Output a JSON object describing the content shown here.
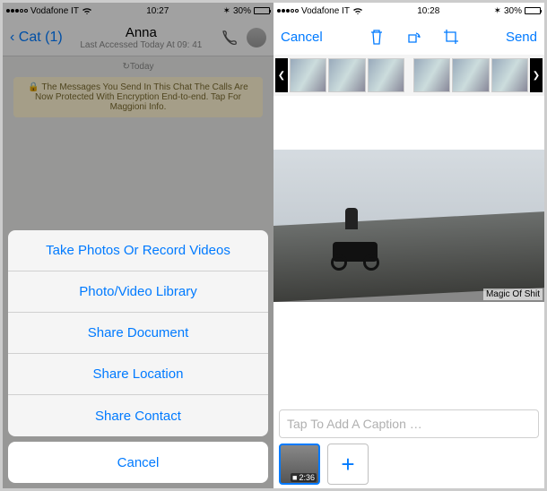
{
  "status": {
    "carrier": "Vodafone IT",
    "time_left": "10:27",
    "time_right": "10:28",
    "battery": "30%"
  },
  "left": {
    "back_label": "Cat (1)",
    "contact_name": "Anna",
    "last_seen": "Last Accessed Today At 09: 41",
    "today_label": "Today",
    "encryption_text": "The Messages You Send In This Chat The Calls Are Now Protected With Encryption End-to-end. Tap For Maggioni Info.",
    "sheet": {
      "items": [
        "Take Photos Or Record Videos",
        "Photo/Video Library",
        "Share Document",
        "Share Location",
        "Share Contact"
      ],
      "cancel": "Cancel"
    }
  },
  "right": {
    "cancel": "Cancel",
    "send": "Send",
    "watermark": "Magic Of Shit",
    "caption_placeholder": "Tap To Add A Caption …",
    "video_duration": "2:36",
    "add_symbol": "+"
  }
}
